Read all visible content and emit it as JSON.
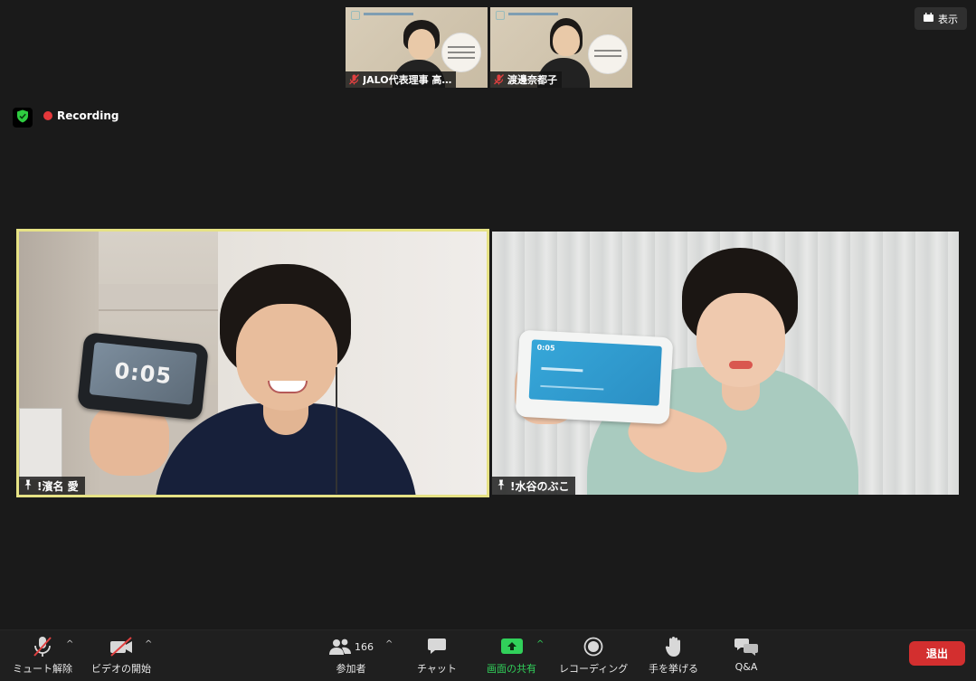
{
  "meeting": {
    "recording_label": "Recording",
    "view_label": "表示"
  },
  "thumbnails": [
    {
      "name": "JALO代表理事 高…",
      "mic_muted": true
    },
    {
      "name": "渡邊奈都子",
      "mic_muted": true
    }
  ],
  "tiles": [
    {
      "name": "!濱名 愛",
      "device_time": "0:05",
      "active_speaker": true
    },
    {
      "name": "!水谷のぶこ",
      "device_time": "0:05",
      "active_speaker": false
    }
  ],
  "toolbar": {
    "mute_label": "ミュート解除",
    "video_label": "ビデオの開始",
    "participants_label": "参加者",
    "participants_count": "166",
    "chat_label": "チャット",
    "share_label": "画面の共有",
    "record_label": "レコーディング",
    "raise_hand_label": "手を挙げる",
    "qa_label": "Q&A",
    "end_label": "退出"
  },
  "colors": {
    "active_border": "#e6e285",
    "end_button": "#d32f2f",
    "share_green": "#31d05a",
    "recording_dot": "#e5383b",
    "security_green": "#2ecc40"
  }
}
